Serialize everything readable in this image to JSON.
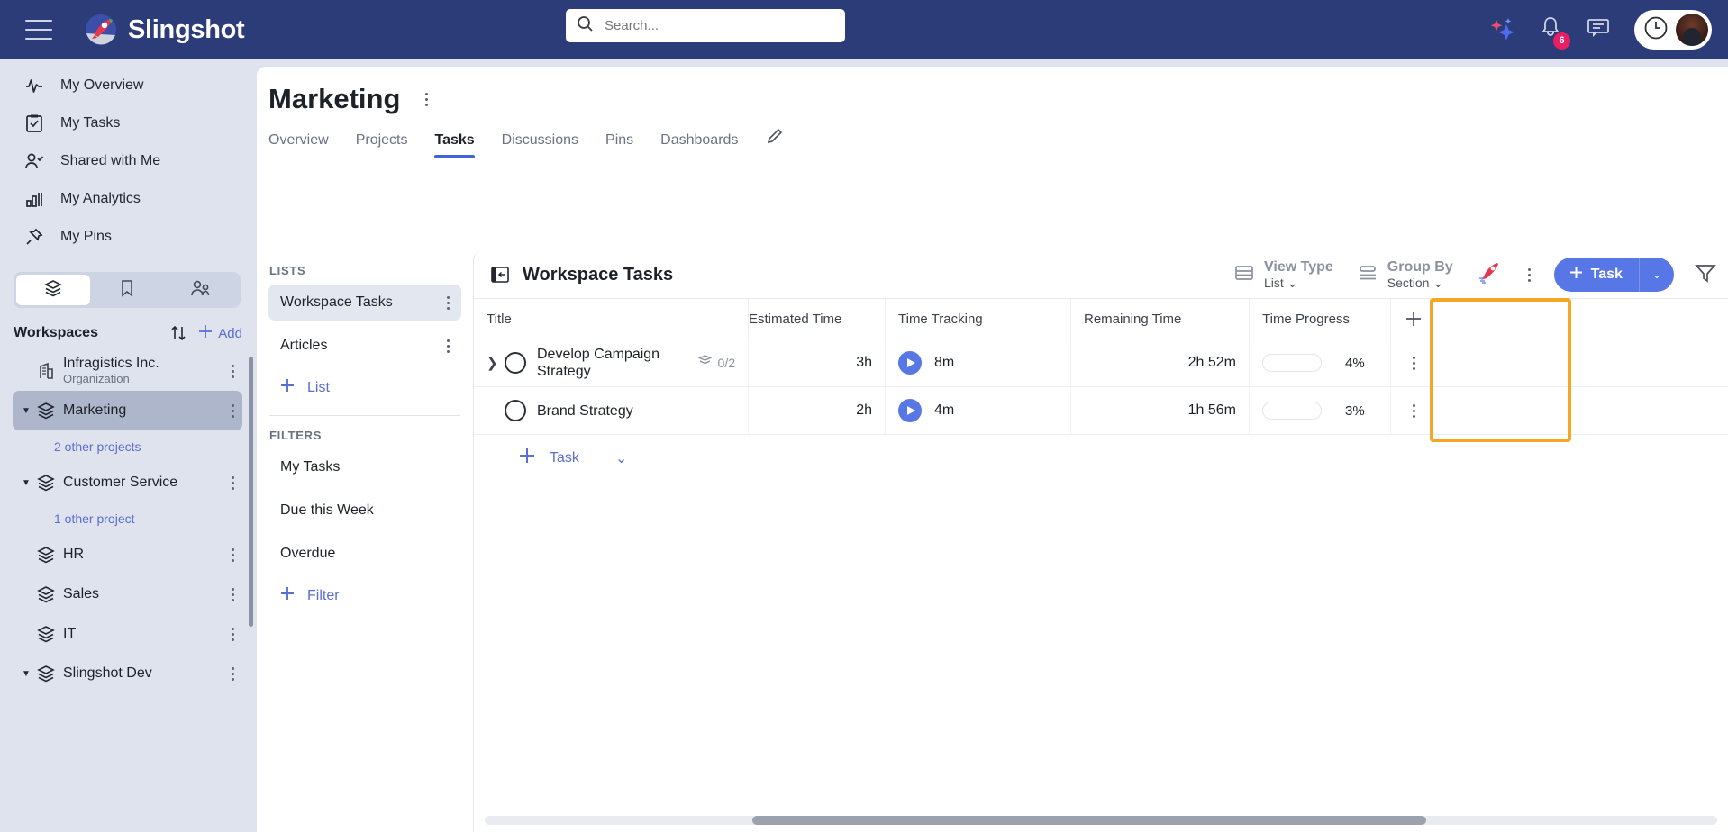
{
  "brand": {
    "name": "Slingshot",
    "logo_icon": "slingshot-rocket-logo"
  },
  "topbar": {
    "menu_icon": "hamburger-menu-icon",
    "search": {
      "placeholder": "Search...",
      "value": "",
      "icon": "search-icon"
    },
    "ai_icon": "sparkle-ai-icon",
    "notifications": {
      "icon": "bell-icon",
      "count": "6"
    },
    "chat_icon": "chat-bubble-icon",
    "time_icon": "clock-icon",
    "avatar": "user-avatar",
    "accent": "#2c3c79"
  },
  "sidebar": {
    "nav": [
      {
        "label": "My Overview",
        "icon": "pulse-activity-icon"
      },
      {
        "label": "My Tasks",
        "icon": "clipboard-check-icon"
      },
      {
        "label": "Shared with Me",
        "icon": "person-check-icon"
      },
      {
        "label": "My Analytics",
        "icon": "bar-chart-icon"
      },
      {
        "label": "My Pins",
        "icon": "pushpin-icon"
      }
    ],
    "segments": [
      {
        "icon": "layers-icon",
        "active": true
      },
      {
        "icon": "bookmark-icon",
        "active": false
      },
      {
        "icon": "people-icon",
        "active": false
      }
    ],
    "workspaces_header": {
      "title": "Workspaces",
      "sort_icon": "sort-arrows-icon",
      "add_label": "Add",
      "add_icon": "plus-icon"
    },
    "workspaces": [
      {
        "label": "Infragistics Inc.",
        "sublabel": "Organization",
        "icon": "building-icon",
        "selected": false,
        "caret": false
      },
      {
        "label": "Marketing",
        "icon": "layers-icon",
        "selected": true,
        "caret": true,
        "other": "2 other projects"
      },
      {
        "label": "Customer Service",
        "icon": "layers-icon",
        "selected": false,
        "caret": true,
        "other": "1 other project"
      },
      {
        "label": "HR",
        "icon": "layers-icon",
        "selected": false,
        "caret": false
      },
      {
        "label": "Sales",
        "icon": "layers-icon",
        "selected": false,
        "caret": false
      },
      {
        "label": "IT",
        "icon": "layers-icon",
        "selected": false,
        "caret": false
      },
      {
        "label": "Slingshot Dev",
        "icon": "layers-icon",
        "selected": false,
        "caret": true
      }
    ]
  },
  "page": {
    "title": "Marketing",
    "kebab_icon": "more-vertical-icon",
    "tabs": [
      {
        "label": "Overview",
        "active": false
      },
      {
        "label": "Projects",
        "active": false
      },
      {
        "label": "Tasks",
        "active": true
      },
      {
        "label": "Discussions",
        "active": false
      },
      {
        "label": "Pins",
        "active": false
      },
      {
        "label": "Dashboards",
        "active": false
      }
    ],
    "edit_icon": "pencil-edit-icon"
  },
  "lists_pane": {
    "lists_header": "LISTS",
    "lists": [
      {
        "label": "Workspace Tasks",
        "selected": true,
        "kebab": "more-vertical-icon"
      },
      {
        "label": "Articles",
        "selected": false,
        "kebab": "more-vertical-icon"
      }
    ],
    "add_list": {
      "label": "List",
      "icon": "plus-icon"
    },
    "filters_header": "FILTERS",
    "filters": [
      {
        "label": "My Tasks"
      },
      {
        "label": "Due this Week"
      },
      {
        "label": "Overdue"
      }
    ],
    "add_filter": {
      "label": "Filter",
      "icon": "plus-icon"
    }
  },
  "task_pane": {
    "collapse_icon": "collapse-panel-left-icon",
    "title": "Workspace Tasks",
    "view_type": {
      "label": "View Type",
      "value": "List",
      "icon": "list-view-icon",
      "caret": "chevron-down-icon"
    },
    "group_by": {
      "label": "Group By",
      "value": "Section",
      "icon": "group-by-icon",
      "caret": "chevron-down-icon"
    },
    "rocket_icon": "rocket-icon",
    "toolbar_kebab": "more-vertical-icon",
    "new_task_button": {
      "label": "Task",
      "plus_icon": "plus-icon",
      "caret_icon": "chevron-down-icon",
      "color": "#5877e6"
    },
    "filter_icon": "funnel-filter-icon",
    "add_column_icon": "plus-icon",
    "columns": [
      "Title",
      "Estimated Time",
      "Time Tracking",
      "Remaining Time",
      "Time Progress"
    ],
    "rows": [
      {
        "expand_icon": "chevron-right-icon",
        "status_icon": "circle-incomplete-icon",
        "title": "Develop Campaign Strategy",
        "subtask_icon": "subtask-icon",
        "subtask_count": "0/2",
        "estimated_time": "3h",
        "play_icon": "play-icon",
        "time_tracked": "8m",
        "remaining_time": "2h 52m",
        "progress_pct": "4%",
        "progress_value": 4,
        "row_kebab": "more-vertical-icon"
      },
      {
        "expand_icon": "",
        "status_icon": "circle-incomplete-icon",
        "title": "Brand Strategy",
        "subtask_icon": "",
        "subtask_count": "",
        "estimated_time": "2h",
        "play_icon": "play-icon",
        "time_tracked": "4m",
        "remaining_time": "1h 56m",
        "progress_pct": "3%",
        "progress_value": 3,
        "row_kebab": "more-vertical-icon"
      }
    ],
    "add_task": {
      "label": "Task",
      "plus_icon": "plus-icon",
      "caret_icon": "chevron-down-icon"
    },
    "highlight_color": "#f5a623",
    "highlight_target": "Time Progress"
  }
}
